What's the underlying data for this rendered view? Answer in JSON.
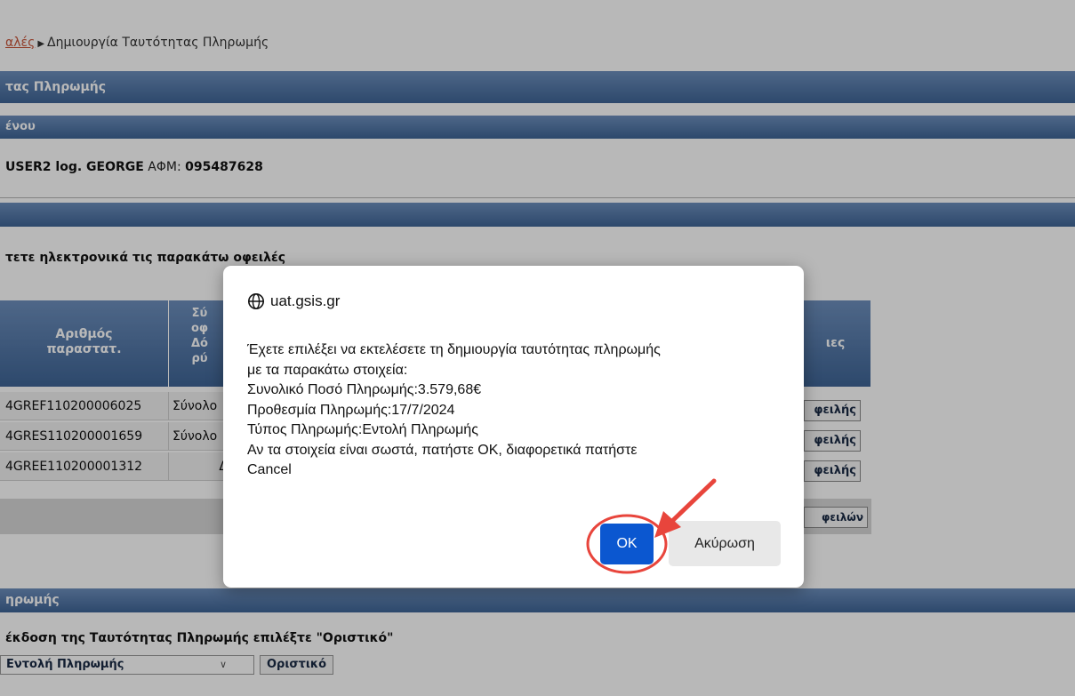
{
  "breadcrumb": {
    "link": "αλές",
    "current": "Δημιουργία Ταυτότητας Πληρωμής"
  },
  "bars": {
    "title": "τας Πληρωμής",
    "section2": "ένου",
    "section4": "ηρωμής"
  },
  "taxpayer": {
    "name": "USER2 log. GEORGE",
    "afm_label": "ΑΦΜ:",
    "afm_value": "095487628"
  },
  "subheading": "τετε ηλεκτρονικά τις παρακάτω οφειλές",
  "table": {
    "col1_header_line1": "Αριθμός",
    "col1_header_line2": "παραστατ.",
    "col2_header_lines": [
      "Σύ",
      "οφ",
      "Δό",
      "ρύ"
    ],
    "col_last_header": "ιες",
    "rows": [
      {
        "doc": "4GREF110200006025",
        "col2": "Σύνολο",
        "action": "φειλής"
      },
      {
        "doc": "4GRES110200001659",
        "col2": "Σύνολο",
        "action": "φειλής"
      },
      {
        "doc": "4GREE110200001312",
        "col2": "Δ",
        "action": "φειλής"
      }
    ],
    "footer_action": "φειλών"
  },
  "payment": {
    "instruction": "έκδοση της Ταυτότητας Πληρωμής επιλέξτε \"Οριστικό\"",
    "select_value": "Εντολή Πληρωμής",
    "final_button": "Οριστικό"
  },
  "dialog": {
    "origin": "uat.gsis.gr",
    "message_lines": [
      "Έχετε επιλέξει να εκτελέσετε τη δημιουργία ταυτότητας πληρωμής",
      "με τα παρακάτω στοιχεία:",
      "Συνολικό Ποσό Πληρωμής:3.579,68€",
      "Προθεσμία Πληρωμής:17/7/2024",
      "Τύπος Πληρωμής:Εντολή Πληρωμής",
      "Αν τα στοιχεία είναι σωστά, πατήστε ΟΚ, διαφορετικά πατήστε",
      "Cancel"
    ],
    "ok_label": "OK",
    "cancel_label": "Ακύρωση"
  },
  "colors": {
    "bar": "#4f74a6",
    "ok_button": "#0b57d0",
    "annotation": "#e8453c"
  }
}
